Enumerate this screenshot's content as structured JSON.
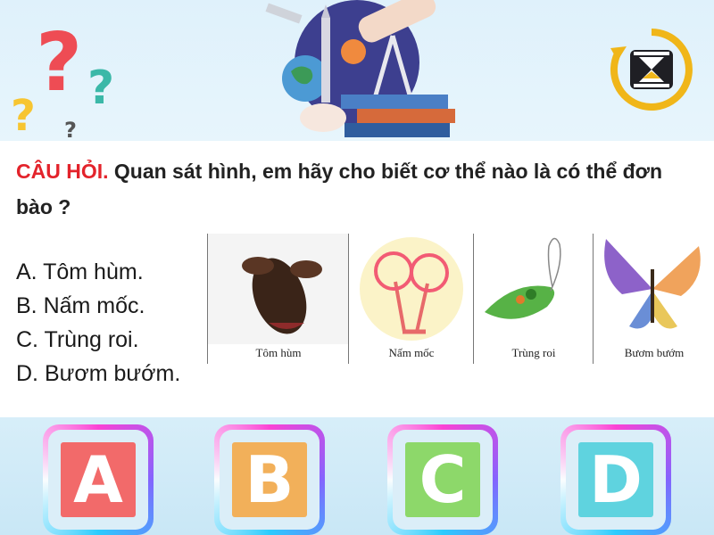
{
  "question": {
    "label": "CÂU HỎI.",
    "text": " Quan sát hình, em hãy cho biết cơ thể nào là có thể đơn bào ?"
  },
  "options": [
    "A. Tôm hùm.",
    "B. Nấm mốc.",
    "C. Trùng roi.",
    "D. Bươm bướm."
  ],
  "figure": {
    "captions": [
      "Tôm hùm",
      "Nấm mốc",
      "Trùng roi",
      "Bươm bướm"
    ]
  },
  "answers": [
    {
      "letter": "A",
      "color": "#f26a6a"
    },
    {
      "letter": "B",
      "color": "#f2b05a"
    },
    {
      "letter": "C",
      "color": "#8dd86a"
    },
    {
      "letter": "D",
      "color": "#5fd3df"
    }
  ],
  "icons": [
    "question-marks-icon",
    "space-science-icon",
    "hourglass-timer-icon"
  ]
}
